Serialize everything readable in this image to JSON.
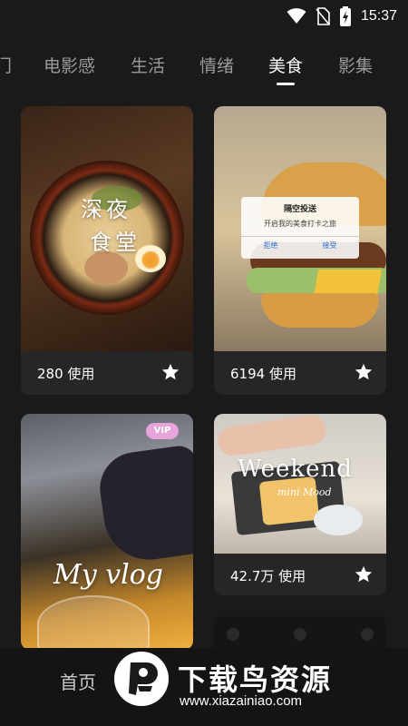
{
  "status_bar": {
    "time": "15:37",
    "icons": [
      "wifi-icon",
      "no-sim-icon",
      "battery-charging-icon"
    ]
  },
  "tabs": [
    {
      "label": "门",
      "active": false
    },
    {
      "label": "电影感",
      "active": false
    },
    {
      "label": "生活",
      "active": false
    },
    {
      "label": "情绪",
      "active": false
    },
    {
      "label": "美食",
      "active": true
    },
    {
      "label": "影集",
      "active": false
    }
  ],
  "templates": [
    {
      "title_line1": "深夜",
      "title_line2": "食堂",
      "usage": "280 使用",
      "favorite_icon": "star-icon"
    },
    {
      "usage": "6194 使用",
      "favorite_icon": "star-icon",
      "dialog": {
        "title": "隔空投送",
        "message": "开启我的美食打卡之旅",
        "decline": "拒绝",
        "accept": "接受"
      }
    },
    {
      "badge": "VIP",
      "title": "My vlog"
    },
    {
      "title": "Weekend",
      "subtitle": "mini Mood",
      "usage": "42.7万 使用",
      "favorite_icon": "star-icon"
    }
  ],
  "bottom_nav": {
    "home": "首页"
  },
  "watermark": {
    "title": "下载鸟资源",
    "url": "www.xiazainiao.com"
  },
  "colors": {
    "background": "#1a1a1a",
    "card": "#262626",
    "tab_inactive": "#9a9a9a",
    "tab_active": "#ffffff"
  }
}
